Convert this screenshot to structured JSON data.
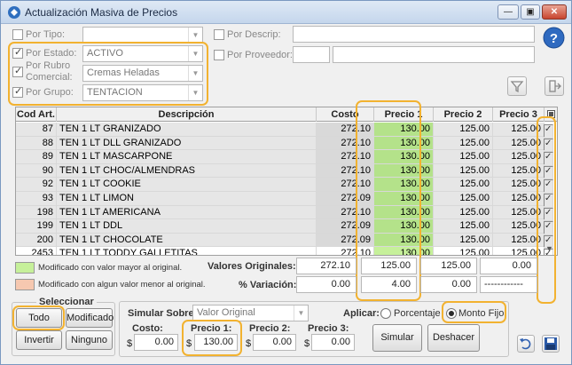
{
  "window": {
    "title": "Actualización Masiva de Precios",
    "accent": "#f2b230"
  },
  "filters": {
    "tipo": {
      "label": "Por Tipo:",
      "value": ""
    },
    "estado": {
      "label": "Por Estado:",
      "value": "ACTIVO"
    },
    "rubro": {
      "label1": "Por Rubro",
      "label2": "Comercial:",
      "value": "Cremas Heladas"
    },
    "grupo": {
      "label": "Por Grupo:",
      "value": "TENTACION"
    },
    "descrip": {
      "label": "Por Descrip:",
      "value": ""
    },
    "proveedor": {
      "label": "Por Proveedor:",
      "value": ""
    }
  },
  "grid": {
    "columns": [
      "Cod Art.",
      "Descripción",
      "Costo",
      "Precio 1",
      "Precio 2",
      "Precio 3"
    ],
    "rows": [
      [
        "87",
        "TEN 1 LT GRANIZADO",
        "272.10",
        "130.00",
        "125.00",
        "125.00"
      ],
      [
        "88",
        "TEN 1 LT DLL GRANIZADO",
        "272.10",
        "130.00",
        "125.00",
        "125.00"
      ],
      [
        "89",
        "TEN 1 LT MASCARPONE",
        "272.10",
        "130.00",
        "125.00",
        "125.00"
      ],
      [
        "90",
        "TEN 1 LT CHOC/ALMENDRAS",
        "272.10",
        "130.00",
        "125.00",
        "125.00"
      ],
      [
        "92",
        "TEN 1 LT COOKIE",
        "272.10",
        "130.00",
        "125.00",
        "125.00"
      ],
      [
        "93",
        "TEN 1 LT LIMON",
        "272.09",
        "130.00",
        "125.00",
        "125.00"
      ],
      [
        "198",
        "TEN 1 LT AMERICANA",
        "272.10",
        "130.00",
        "125.00",
        "125.00"
      ],
      [
        "199",
        "TEN 1 LT DDL",
        "272.09",
        "130.00",
        "125.00",
        "125.00"
      ],
      [
        "200",
        "TEN 1 LT CHOCOLATE",
        "272.09",
        "130.00",
        "125.00",
        "125.00"
      ],
      [
        "2453",
        "TEN 1 LT TODDY GALLETITAS",
        "272.10",
        "130.00",
        "125.00",
        "125.00"
      ]
    ]
  },
  "legend": {
    "higher": {
      "text": "Modificado con valor mayor al original.",
      "color": "#c6f09a"
    },
    "lower": {
      "text": "Modificado con algun valor menor al original.",
      "color": "#f6c8b0"
    }
  },
  "summary": {
    "originales_label": "Valores Originales:",
    "originales": [
      "272.10",
      "125.00",
      "125.00",
      "0.00"
    ],
    "variacion_label": "% Variación:",
    "variacion": [
      "0.00",
      "4.00",
      "0.00",
      "------------"
    ]
  },
  "seleccionar": {
    "title": "Seleccionar",
    "todo": "Todo",
    "modificado": "Modificado",
    "invertir": "Invertir",
    "ninguno": "Ninguno"
  },
  "simular": {
    "sobre_label": "Simular Sobre:",
    "sobre_value": "Valor Original",
    "aplicar_label": "Aplicar:",
    "porcentaje": "Porcentaje",
    "monto_fijo": "Monto Fijo",
    "costo_label": "Costo:",
    "costo": "0.00",
    "precio1_label": "Precio 1:",
    "precio1": "130.00",
    "precio2_label": "Precio 2:",
    "precio2": "0.00",
    "precio3_label": "Precio 3:",
    "precio3": "0.00",
    "dollar": "$",
    "simular_btn": "Simular",
    "deshacer_btn": "Deshacer"
  }
}
